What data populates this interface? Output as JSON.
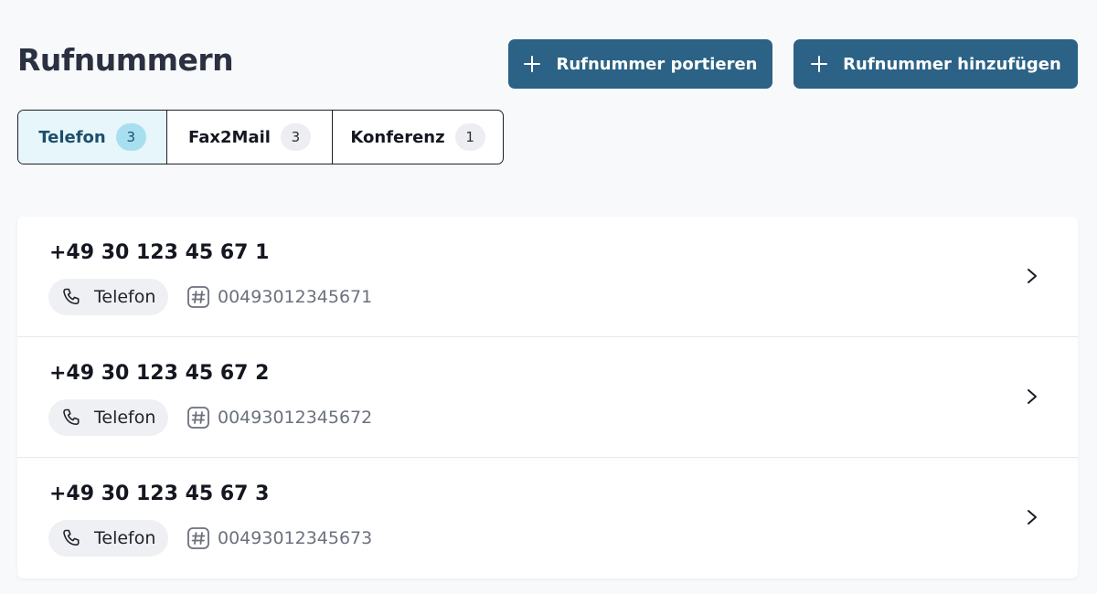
{
  "header": {
    "title": "Rufnummern",
    "port_button_label": "Rufnummer portieren",
    "add_button_label": "Rufnummer hinzufügen"
  },
  "tabs": [
    {
      "label": "Telefon",
      "count": "3",
      "active": true
    },
    {
      "label": "Fax2Mail",
      "count": "3",
      "active": false
    },
    {
      "label": "Konferenz",
      "count": "1",
      "active": false
    }
  ],
  "numbers": [
    {
      "display": "+49 30 123 45 67 1",
      "type_label": "Telefon",
      "digits": "00493012345671"
    },
    {
      "display": "+49 30 123 45 67 2",
      "type_label": "Telefon",
      "digits": "00493012345672"
    },
    {
      "display": "+49 30 123 45 67 3",
      "type_label": "Telefon",
      "digits": "00493012345673"
    }
  ],
  "icons": {
    "add": "plus-icon",
    "type": "phone-icon",
    "digits": "hash-icon",
    "open": "chevron-right-icon"
  },
  "colors": {
    "primary_button": "#2b6285",
    "active_tab_bg": "#e6f6fa",
    "active_badge_bg": "#a8dff0"
  }
}
